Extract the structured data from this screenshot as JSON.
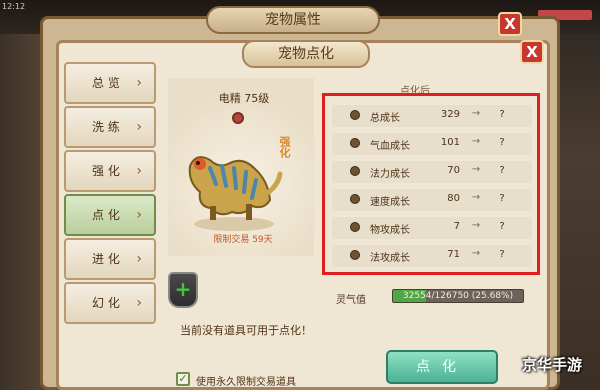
{
  "top_bar": {
    "time": "12:12"
  },
  "outer_window": {
    "title": "宠物属性",
    "close_label": "X"
  },
  "panel": {
    "title": "宠物点化",
    "close_label": "X"
  },
  "tabs": [
    {
      "label": "总 览",
      "active": false
    },
    {
      "label": "洗 练",
      "active": false
    },
    {
      "label": "强 化",
      "active": false
    },
    {
      "label": "点 化",
      "active": true
    },
    {
      "label": "进 化",
      "active": false
    },
    {
      "label": "幻 化",
      "active": false
    }
  ],
  "tab_arrow": "›",
  "pet": {
    "name_level": "电精 75级",
    "side_label": "强化",
    "trade_limit": "限制交易 59天"
  },
  "column_headers": {
    "current": "点化前",
    "next": "点化后"
  },
  "stats": [
    {
      "label": "总成长",
      "value": "329",
      "arrow": "→",
      "next": "?"
    },
    {
      "label": "气血成长",
      "value": "101",
      "arrow": "→",
      "next": "?"
    },
    {
      "label": "法力成长",
      "value": "70",
      "arrow": "→",
      "next": "?"
    },
    {
      "label": "速度成长",
      "value": "80",
      "arrow": "→",
      "next": "?"
    },
    {
      "label": "物攻成长",
      "value": "7",
      "arrow": "→",
      "next": "?"
    },
    {
      "label": "法攻成长",
      "value": "71",
      "arrow": "→",
      "next": "?"
    }
  ],
  "spirit": {
    "label": "灵气值",
    "text": "32554/126750 (25.68%)",
    "fraction": 0.2568
  },
  "item_slot": {
    "plus": "+"
  },
  "no_item_text": "当前没有道具可用于点化！",
  "checkbox": {
    "checked": true,
    "mark": "✓",
    "label": "使用永久限制交易道具"
  },
  "action_button": {
    "label": "点化"
  },
  "watermark": "京华手游",
  "colors": {
    "highlight": "#e01f22",
    "active_tab": "#b9cf9b",
    "button": "#4cb293",
    "spirit_fill": "#4fa745"
  }
}
